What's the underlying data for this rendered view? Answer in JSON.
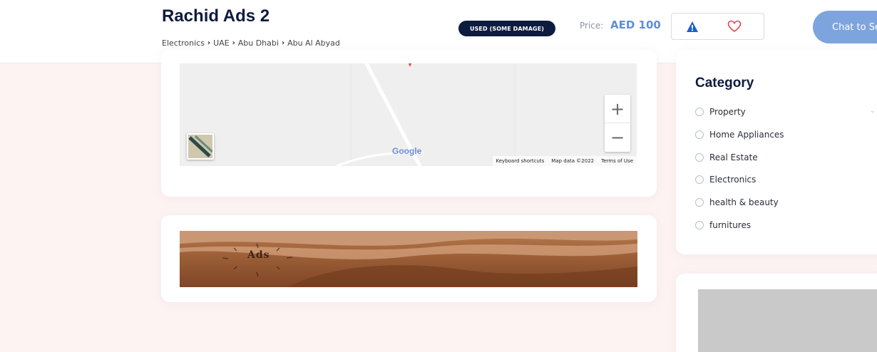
{
  "header": {
    "title": "Rachid Ads 2",
    "breadcrumb": [
      "Electronics",
      "UAE",
      "Abu Dhabi",
      "Abu Al Abyad"
    ],
    "condition": "USED (SOME DAMAGE)",
    "price_label": "Price:",
    "price_value": "AED 100",
    "chat_button": "Chat to Seller",
    "report_icon": "warning-icon",
    "favorite_icon": "heart-icon"
  },
  "map": {
    "google_label": "Google",
    "footer": [
      "Keyboard shortcuts",
      "Map data ©2022",
      "Terms of Use"
    ],
    "zoom_in": "+",
    "zoom_out": "−"
  },
  "banner": {
    "logo_text": "Ads"
  },
  "sidebar": {
    "category_title": "Category",
    "categories": [
      "Property",
      "Home Appliances",
      "Real Estate",
      "Electronics",
      "health & beauty",
      "furnitures"
    ]
  },
  "colors": {
    "navy": "#0d1b3e",
    "accent_blue": "#5f8fd6",
    "chat_button": "#7ea4de",
    "heart": "#e0454f",
    "warning": "#1a5fd0"
  }
}
